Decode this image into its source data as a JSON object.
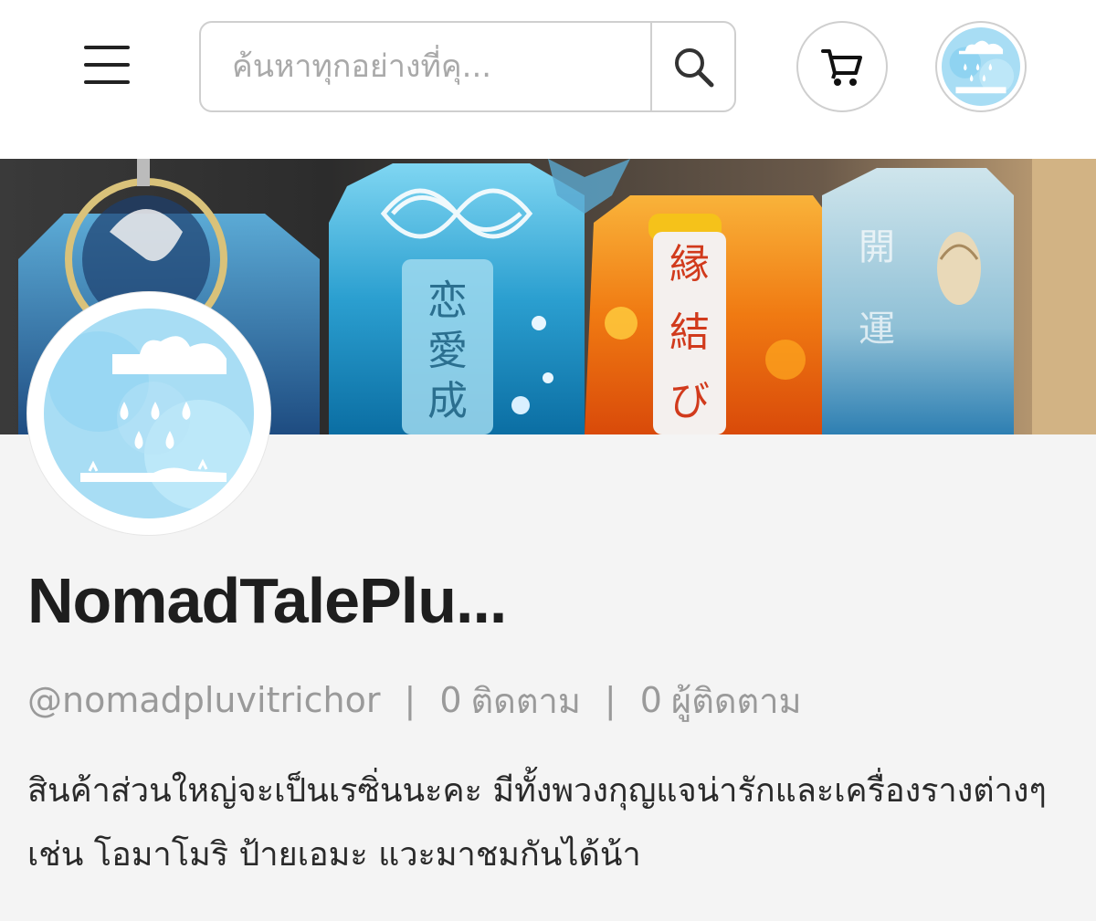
{
  "header": {
    "search": {
      "placeholder": "ค้นหาทุกอย่างที่คุ..."
    },
    "icons": {
      "menu": "hamburger-icon",
      "search": "search-icon",
      "cart": "cart-icon"
    }
  },
  "shop": {
    "name": "NomadTalePlu...",
    "handle": "@nomadpluvitrichor",
    "separator": "|",
    "following_count": "0",
    "following_label": "ติดตาม",
    "followers_count": "0",
    "followers_label": "ผู้ติดตาม",
    "bio": "สินค้าส่วนใหญ่จะเป็นเรซิ่นนะคะ มีทั้งพวงกุญแจน่ารักและเครื่องรางต่างๆ เช่น โอมาโมริ ป้ายเอมะ แวะมาชมกันได้น้า"
  },
  "cover": {
    "charm_texts": [
      "恋愛成",
      "縁結び",
      "開運"
    ]
  },
  "colors": {
    "avatar_bg": "#a8ddf4",
    "accent": "#5ec4ec"
  }
}
